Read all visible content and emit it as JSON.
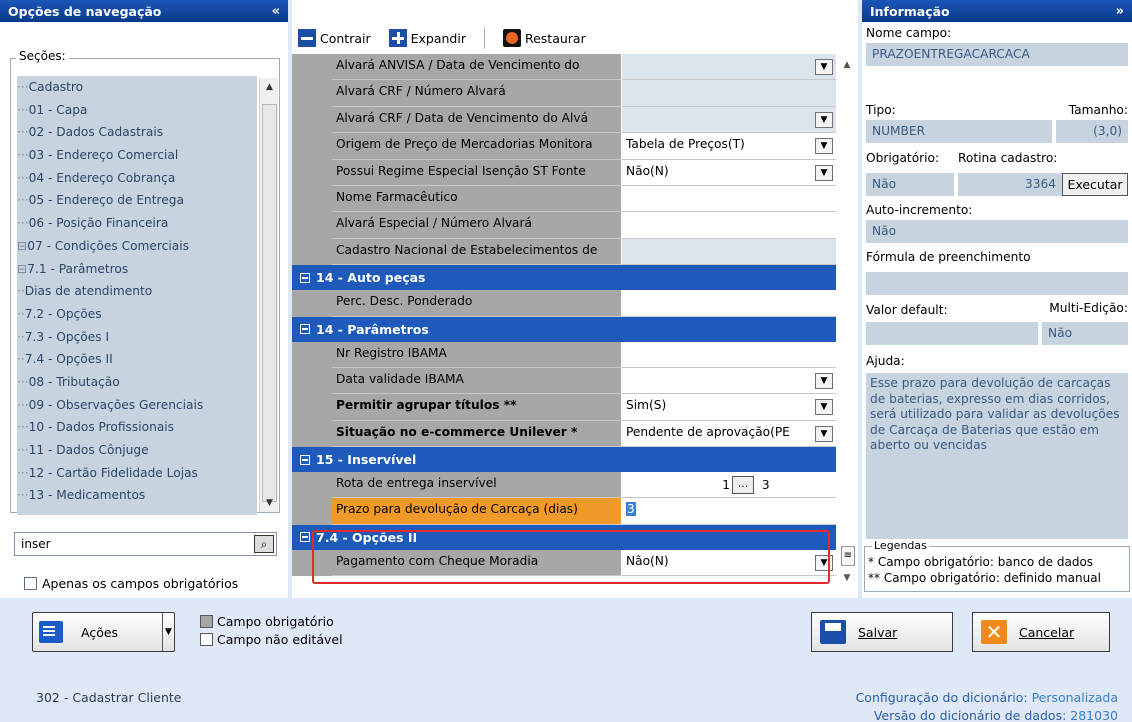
{
  "left_panel": {
    "title": "Opções de navegação",
    "collapse_icon": "«",
    "sections_label": "Seções:",
    "tree": [
      {
        "label": "Cadastro",
        "prefix": "···"
      },
      {
        "label": "01 - Capa",
        "prefix": "···"
      },
      {
        "label": "02 - Dados Cadastrais",
        "prefix": "···"
      },
      {
        "label": "03 - Endereço Comercial",
        "prefix": "···"
      },
      {
        "label": "04 - Endereço Cobrança",
        "prefix": "···"
      },
      {
        "label": "05 - Endereço de Entrega",
        "prefix": "···"
      },
      {
        "label": "06 - Posição Financeira",
        "prefix": "···"
      },
      {
        "label": "07 - Condições Comerciais",
        "prefix": "⊟"
      },
      {
        "label": "7.1 - Parâmetros",
        "prefix": "    ⊟"
      },
      {
        "label": "Dias de atendimento",
        "prefix": "          ··"
      },
      {
        "label": "7.2 - Opções",
        "prefix": "      ··"
      },
      {
        "label": "7.3 - Opções I",
        "prefix": "      ··"
      },
      {
        "label": "7.4 - Opções II",
        "prefix": "      ··"
      },
      {
        "label": "08 - Tributação",
        "prefix": "···"
      },
      {
        "label": "09 - Observações Gerenciais",
        "prefix": "···"
      },
      {
        "label": "10 - Dados Profissionais",
        "prefix": "···"
      },
      {
        "label": "11 - Dados Cônjuge",
        "prefix": "···"
      },
      {
        "label": "12 - Cartão Fidelidade Lojas",
        "prefix": "···"
      },
      {
        "label": "13 - Medicamentos",
        "prefix": "···"
      }
    ],
    "search_value": "inser",
    "only_required_label": "Apenas os campos obrigatórios"
  },
  "toolbar": {
    "collapse_label": "Contrair",
    "expand_label": "Expandir",
    "restore_label": "Restaurar"
  },
  "grid": {
    "rows_a": [
      {
        "label": "Alvará ANVISA / Data  de Vencimento do",
        "value": "",
        "dropdown": true,
        "gray": true
      },
      {
        "label": "Alvará CRF / Número Alvará",
        "value": "",
        "dropdown": false,
        "gray": true
      },
      {
        "label": "Alvará CRF / Data  de Vencimento do Alvá",
        "value": "",
        "dropdown": true,
        "gray": true
      },
      {
        "label": "Origem de Preço de Mercadorias Monitora",
        "value": "Tabela de Preços(T)",
        "dropdown": true,
        "gray": false
      },
      {
        "label": "Possui Regime Especial Isenção ST Fonte",
        "value": "Não(N)",
        "dropdown": true,
        "gray": false
      },
      {
        "label": "Nome Farmacêutico",
        "value": "",
        "dropdown": false,
        "gray": false
      },
      {
        "label": "Alvará Especial / Número Alvará",
        "value": "",
        "dropdown": false,
        "gray": false
      },
      {
        "label": "Cadastro Nacional de Estabelecimentos de",
        "value": "",
        "dropdown": false,
        "gray": true
      }
    ],
    "section_autopecas": "14 - Auto peças",
    "row_perc": {
      "label": "Perc. Desc. Ponderado",
      "value": ""
    },
    "section_parametros": "14 - Parâmetros",
    "rows_b": [
      {
        "label": "Nr Registro IBAMA",
        "value": "",
        "dropdown": false,
        "bold": false
      },
      {
        "label": "Data validade IBAMA",
        "value": "",
        "dropdown": true,
        "bold": false
      },
      {
        "label": "Permitir agrupar títulos **",
        "value": "Sim(S)",
        "dropdown": true,
        "bold": true
      },
      {
        "label": "Situação no e-commerce Unilever *",
        "value": "Pendente de aprovação(PE",
        "dropdown": true,
        "bold": true
      }
    ],
    "section_inservivel": "15 - Inservível",
    "row_rota": {
      "label": "Rota de entrega inservível",
      "value": "1",
      "button": "...",
      "extra": "3"
    },
    "row_prazo": {
      "label": "Prazo para devolução de Carcaça (dias)",
      "value": "3"
    },
    "section_opcoes2": "7.4 - Opções II",
    "row_pagamento": {
      "label": "Pagamento com Cheque Moradia",
      "value": "Não(N)"
    }
  },
  "right_panel": {
    "title": "Informação",
    "expand_icon": "»",
    "field_name_label": "Nome campo:",
    "field_name": "PRAZOENTREGACARCACA",
    "type_label": "Tipo:",
    "size_label": "Tamanho:",
    "type": "NUMBER",
    "size": "(3,0)",
    "required_label": "Obrigatório:",
    "routine_label": "Rotina cadastro:",
    "required": "Não",
    "routine": "3364",
    "execute_label": "Executar",
    "autoinc_label": "Auto-incremento:",
    "autoinc": "Não",
    "formula_label": "Fórmula de preenchimento",
    "formula": "",
    "default_label": "Valor default:",
    "multi_label": "Multi-Edição:",
    "default": "",
    "multi": "Não",
    "help_label": "Ajuda:",
    "help_text": "Esse prazo para devolução de carcaças de baterias, expresso em dias corridos, será utilizado para validar as devoluções de Carcaça de Baterias que estão em aberto ou vencidas",
    "legend_title": "Legendas",
    "legend_1": "* Campo obrigatório: banco de dados",
    "legend_2": "** Campo obrigatório: definido manual"
  },
  "bottom": {
    "actions_label": "Ações",
    "legend_required": "Campo obrigatório",
    "legend_readonly": "Campo não editável",
    "save_label": "Salvar",
    "cancel_label": "Cancelar"
  },
  "status": {
    "routine": "302 - Cadastrar Cliente",
    "config_label": "Configuração do dicionário:",
    "config_value": "Personalizada",
    "version_label": "Versão do dicionário de dados:",
    "version_value": "281030"
  },
  "colors": {
    "header_blue": "#1b56b8",
    "section_blue": "#1e5abc",
    "highlight_orange": "#f19a2a",
    "highlight_border_red": "#e22a2a"
  }
}
